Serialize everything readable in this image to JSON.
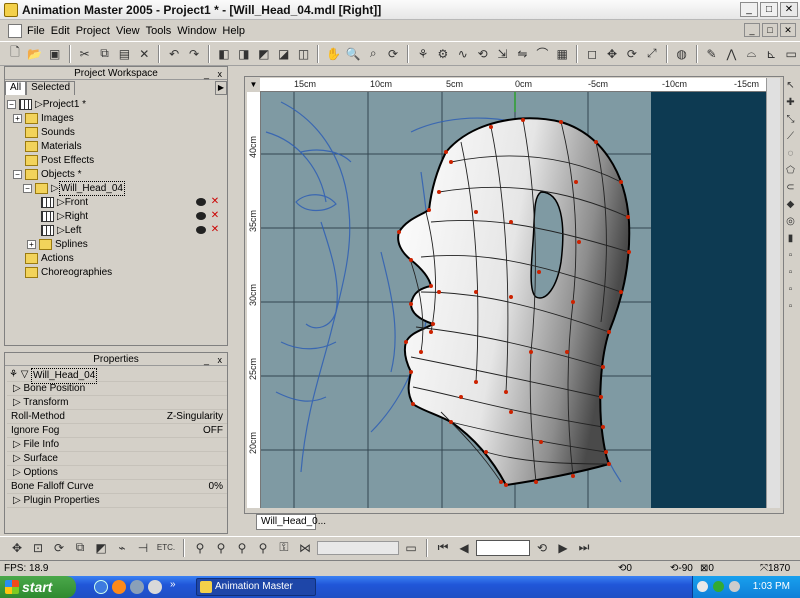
{
  "window": {
    "title": "Animation Master 2005 - Project1 * - [Will_Head_04.mdl [Right]]",
    "buttons": [
      "_",
      "□",
      "✕"
    ]
  },
  "menubar": {
    "items": [
      "File",
      "Edit",
      "Project",
      "View",
      "Tools",
      "Window",
      "Help"
    ]
  },
  "project_workspace": {
    "title": "Project Workspace",
    "tabs": [
      "All",
      "Selected"
    ],
    "tree": {
      "project": "Project1 *",
      "images": "Images",
      "sounds": "Sounds",
      "materials": "Materials",
      "post_effects": "Post Effects",
      "objects": "Objects *",
      "model": "Will_Head_04",
      "cameras": [
        "Front",
        "Right",
        "Left"
      ],
      "splines": "Splines",
      "actions": "Actions",
      "choreographies": "Choreographies"
    }
  },
  "properties": {
    "title": "Properties",
    "object_name": "Will_Head_04",
    "rows": [
      {
        "label": "Bone Position",
        "value": "",
        "expander": true
      },
      {
        "label": "Transform",
        "value": "",
        "expander": true
      },
      {
        "label": "Roll-Method",
        "value": "Z-Singularity",
        "expander": false
      },
      {
        "label": "Ignore Fog",
        "value": "OFF",
        "expander": false
      },
      {
        "label": "File Info",
        "value": "",
        "expander": true
      },
      {
        "label": "Surface",
        "value": "",
        "expander": true
      },
      {
        "label": "Options",
        "value": "",
        "expander": true
      },
      {
        "label": "Bone Falloff Curve",
        "value": "0%",
        "expander": false
      },
      {
        "label": "Plugin Properties",
        "value": "",
        "expander": true
      }
    ]
  },
  "viewport": {
    "tab_label": "Will_Head_0...",
    "ruler_top": [
      "15cm",
      "10cm",
      "5cm",
      "0cm",
      "-5cm",
      "-10cm",
      "-15cm"
    ],
    "ruler_left": [
      "40cm",
      "35cm",
      "30cm",
      "25cm",
      "20cm"
    ],
    "background_color": "#7f9aa3",
    "grid_color": "#1a2a35",
    "dark_panel_color": "#0d3a52",
    "wire_color": "#cc2200"
  },
  "bottom_toolbar": {
    "etc_label": "ETC."
  },
  "status": {
    "fps": "FPS: 18.9",
    "v1": "0",
    "v2": "-90",
    "v3": "0",
    "count": "1870"
  },
  "taskbar": {
    "start": "start",
    "task_button": "Animation Master 200...",
    "clock": "1:03 PM"
  }
}
